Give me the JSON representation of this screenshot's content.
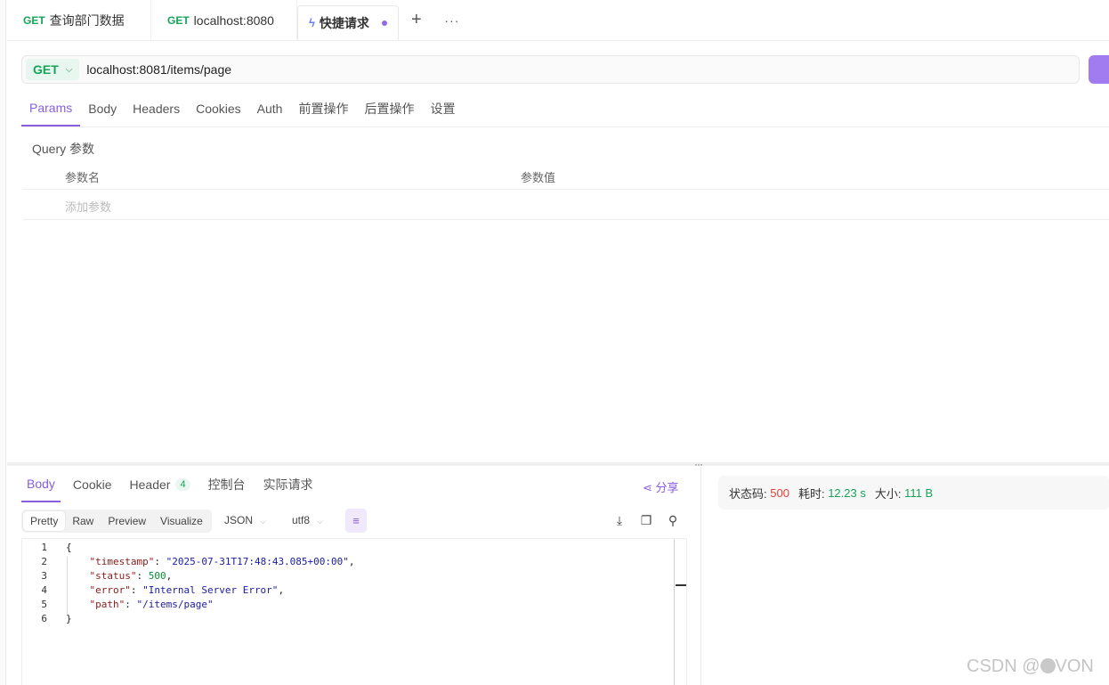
{
  "tabs": [
    {
      "method": "GET",
      "title": "查询部门数据"
    },
    {
      "method": "GET",
      "title": "localhost:8080"
    },
    {
      "title": "快捷请求"
    }
  ],
  "tab_tools": {
    "add": "+",
    "more": "···"
  },
  "request": {
    "method": "GET",
    "url": "localhost:8081/items/page"
  },
  "request_tabs": [
    "Params",
    "Body",
    "Headers",
    "Cookies",
    "Auth",
    "前置操作",
    "后置操作",
    "设置"
  ],
  "params": {
    "section_title": "Query 参数",
    "col_name": "参数名",
    "col_value": "参数值",
    "add_placeholder": "添加参数"
  },
  "response_tabs": [
    {
      "label": "Body"
    },
    {
      "label": "Cookie"
    },
    {
      "label": "Header",
      "badge": "4"
    },
    {
      "label": "控制台"
    },
    {
      "label": "实际请求"
    }
  ],
  "share_label": "分享",
  "format": {
    "modes": [
      "Pretty",
      "Raw",
      "Preview",
      "Visualize"
    ],
    "type": "JSON",
    "encoding": "utf8"
  },
  "code_lines": [
    {
      "n": "1",
      "indent": "",
      "parts": [
        {
          "t": "{",
          "c": ""
        }
      ]
    },
    {
      "n": "2",
      "indent": "    ",
      "parts": [
        {
          "t": "\"timestamp\"",
          "c": "k"
        },
        {
          "t": ": ",
          "c": ""
        },
        {
          "t": "\"2025-07-31T17:48:43.085+00:00\"",
          "c": "s"
        },
        {
          "t": ",",
          "c": ""
        }
      ]
    },
    {
      "n": "3",
      "indent": "    ",
      "parts": [
        {
          "t": "\"status\"",
          "c": "k"
        },
        {
          "t": ": ",
          "c": ""
        },
        {
          "t": "500",
          "c": "n"
        },
        {
          "t": ",",
          "c": ""
        }
      ]
    },
    {
      "n": "4",
      "indent": "    ",
      "parts": [
        {
          "t": "\"error\"",
          "c": "k"
        },
        {
          "t": ": ",
          "c": ""
        },
        {
          "t": "\"Internal Server Error\"",
          "c": "s"
        },
        {
          "t": ",",
          "c": ""
        }
      ]
    },
    {
      "n": "5",
      "indent": "    ",
      "parts": [
        {
          "t": "\"path\"",
          "c": "k"
        },
        {
          "t": ": ",
          "c": ""
        },
        {
          "t": "\"/items/page\"",
          "c": "s"
        }
      ]
    },
    {
      "n": "6",
      "indent": "",
      "parts": [
        {
          "t": "}",
          "c": ""
        }
      ]
    }
  ],
  "status": {
    "code_label": "状态码:",
    "code": "500",
    "time_label": "耗时:",
    "time": "12.23 s",
    "size_label": "大小:",
    "size": "111 B"
  },
  "watermark": {
    "prefix": "CSDN @",
    "suffix": "VON"
  },
  "colors": {
    "accent": "#8a5de0",
    "get": "#16a35a",
    "error": "#e0433a"
  }
}
